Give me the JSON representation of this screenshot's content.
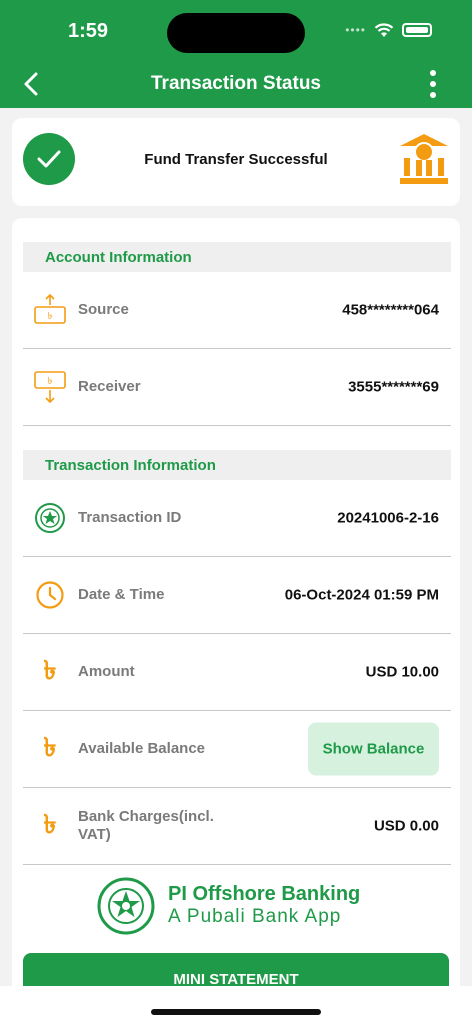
{
  "status_bar": {
    "time": "1:59"
  },
  "header": {
    "title": "Transaction Status"
  },
  "status_card": {
    "message": "Fund Transfer Successful"
  },
  "account_section": {
    "title": "Account Information",
    "rows": [
      {
        "label": "Source",
        "value": "458********064",
        "icon": "send-out-icon"
      },
      {
        "label": "Receiver",
        "value": "3555*******69",
        "icon": "receive-in-icon"
      }
    ]
  },
  "transaction_section": {
    "title": "Transaction Information",
    "transaction_id": {
      "label": "Transaction ID",
      "value": "20241006-2-16"
    },
    "date_time": {
      "label": "Date & Time",
      "value": "06-Oct-2024 01:59 PM"
    },
    "amount": {
      "label": "Amount",
      "value": "USD 10.00"
    },
    "available_balance": {
      "label": "Available Balance",
      "button": "Show Balance"
    },
    "bank_charges": {
      "label_line1": "Bank Charges(incl.",
      "label_line2": "VAT)",
      "value": "USD 0.00"
    },
    "taka_symbol": "৳"
  },
  "brand": {
    "name": "PI Offshore Banking",
    "tagline": "A Pubali Bank App"
  },
  "actions": {
    "mini_statement": "MINI STATEMENT"
  },
  "colors": {
    "primary": "#1e9a48",
    "accent": "#f39c12",
    "light_green": "#d6f2df"
  }
}
